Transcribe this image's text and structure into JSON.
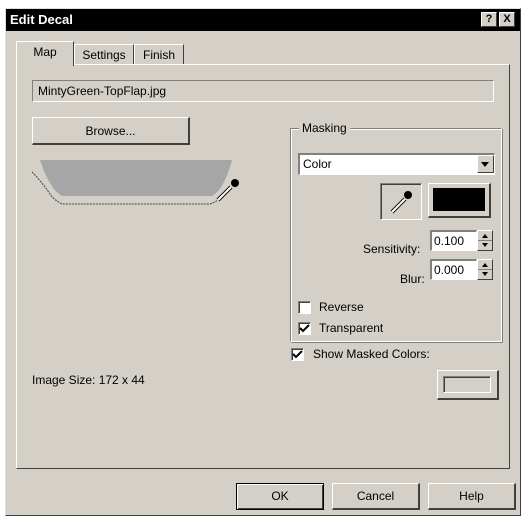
{
  "window": {
    "title": "Edit Decal",
    "help_glyph": "?",
    "close_glyph": "X"
  },
  "tabs": [
    {
      "label": "Map",
      "active": true
    },
    {
      "label": "Settings",
      "active": false
    },
    {
      "label": "Finish",
      "active": false
    }
  ],
  "map": {
    "filename": "MintyGreen-TopFlap.jpg",
    "browse_label": "Browse...",
    "image_size_text": "Image Size: 172 x 44"
  },
  "masking": {
    "group_label": "Masking",
    "mode_value": "Color",
    "mask_color": "#000000",
    "sensitivity_label": "Sensitivity:",
    "sensitivity_value": "0.100",
    "blur_label": "Blur:",
    "blur_value": "0.000",
    "reverse_label": "Reverse",
    "reverse_checked": false,
    "transparent_label": "Transparent",
    "transparent_checked": true
  },
  "show_masked": {
    "label": "Show Masked Colors:",
    "checked": true
  },
  "footer": {
    "ok_label": "OK",
    "cancel_label": "Cancel",
    "help_label": "Help"
  },
  "colors": {
    "dialog_bg": "#d4d0c8",
    "preview_gray": "#a6a6a6",
    "title_bg": "#000000"
  },
  "icons": {
    "eyedropper": "eyedropper-icon",
    "combo_arrow": "chevron-down-icon",
    "spin_up": "spin-up-icon",
    "spin_down": "spin-down-icon",
    "check": "checkmark-icon"
  }
}
